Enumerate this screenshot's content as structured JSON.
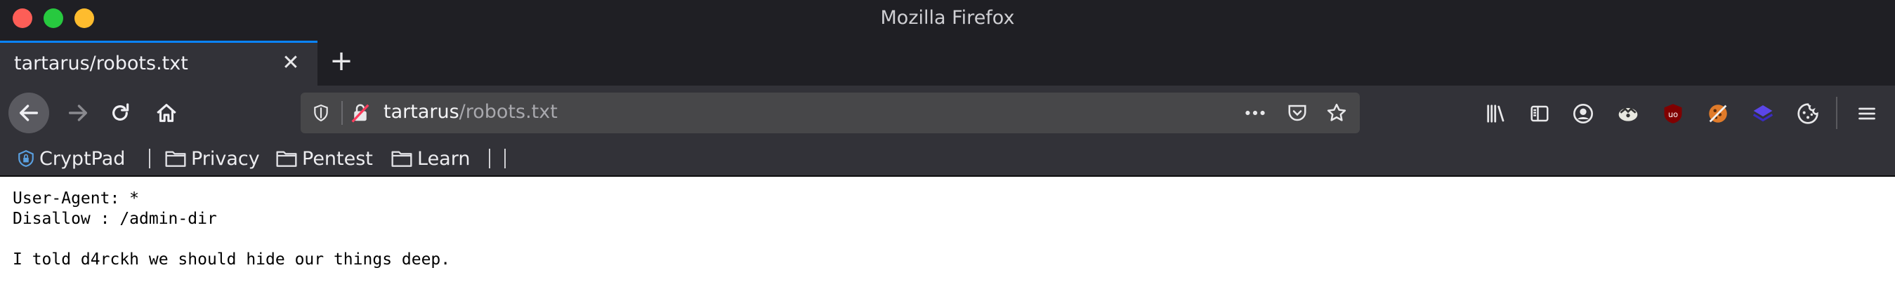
{
  "window": {
    "title": "Mozilla Firefox"
  },
  "tab": {
    "title": "tartarus/robots.txt"
  },
  "urlbar": {
    "host": "tartarus",
    "path": "/robots.txt"
  },
  "bookmarks": [
    {
      "label": "CryptPad",
      "icon": "cryptpad-icon"
    },
    {
      "label": "Privacy",
      "icon": "folder-icon"
    },
    {
      "label": "Pentest",
      "icon": "folder-icon"
    },
    {
      "label": "Learn",
      "icon": "folder-icon"
    }
  ],
  "content": {
    "lines": [
      "User-Agent: *",
      "Disallow : /admin-dir",
      "",
      "I told d4rckh we should hide our things deep."
    ]
  },
  "colors": {
    "accent": "#0a84ff",
    "chrome_dark": "#1f1f24",
    "toolbar": "#323238",
    "urlbar_bg": "#474749"
  }
}
